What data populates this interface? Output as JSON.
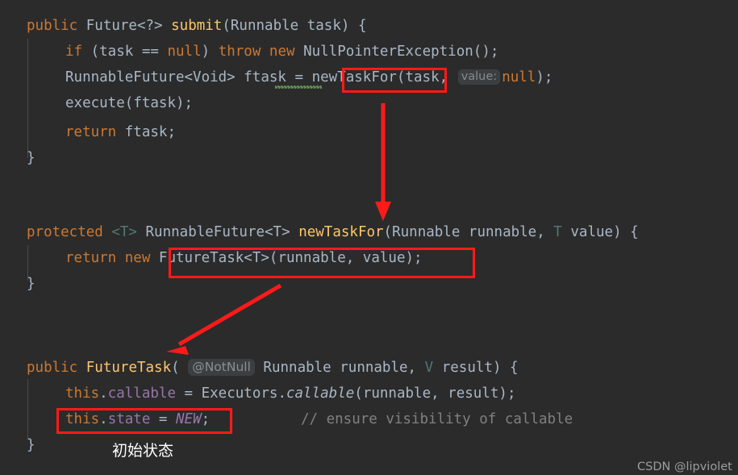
{
  "editor": {
    "background": "#2b2b2b",
    "default_text_color": "#a9b7c6",
    "keyword_color": "#cc7832",
    "method_color": "#ffc66d",
    "field_color": "#9876aa",
    "comment_color": "#808080",
    "annotation_color": "#ff1a1a",
    "language": "Java"
  },
  "code": {
    "block1": {
      "line1": {
        "kw_public": "public",
        "type_future": " Future<?> ",
        "method": "submit",
        "open_paren": "(",
        "param_type": "Runnable",
        "param_name": " task",
        "tail": ") {"
      },
      "line2": {
        "kw_if": "if",
        "cond_open": " (task ",
        "op_eq": "==",
        "kw_null": " null",
        "cond_close": ") ",
        "kw_throw": "throw",
        "kw_new": " new",
        "exception": " NullPointerException",
        "tail": "();"
      },
      "line3": {
        "decl_type": "RunnableFuture<Void>",
        "var": " ftask ",
        "assign": "= ",
        "call": "newTaskFor",
        "open_paren": "(",
        "arg1": "task, ",
        "hint": "value:",
        "arg2": "null",
        "tail": ");"
      },
      "line4": {
        "call": "execute",
        "open_paren": "(",
        "arg": "ftask",
        "tail": ");"
      },
      "line5": {
        "kw_return": "return",
        "value": " ftask",
        "tail": ";"
      },
      "line6": {
        "brace": "}"
      }
    },
    "block2": {
      "line1": {
        "kw_protected": "protected",
        "generic": " <T> ",
        "ret_type": "RunnableFuture<T>",
        "space": " ",
        "method": "newTaskFor",
        "open_paren": "(",
        "p1_type": "Runnable",
        "p1_name": " runnable, ",
        "p2_type": "T",
        "p2_name": " value",
        "tail": ") {"
      },
      "line2": {
        "kw_return": "return",
        "kw_new": " new",
        "space": " ",
        "ctor": "FutureTask<T>",
        "open_paren": "(",
        "args": "runnable, value",
        "tail": ");"
      },
      "line3": {
        "brace": "}"
      }
    },
    "block3": {
      "line1": {
        "kw_public": "public",
        "space": " ",
        "ctor": "FutureTask",
        "open_paren": "( ",
        "annotation": "@NotNull",
        "p1_type": " Runnable",
        "p1_name": " runnable, ",
        "p2_type": "V",
        "p2_name": " result",
        "tail": ") {"
      },
      "line2": {
        "kw_this": "this",
        "dot": ".",
        "field": "callable",
        "assign": " = ",
        "class_name": "Executors",
        "dot2": ".",
        "static_method": "callable",
        "open_paren": "(",
        "args": "runnable, result",
        "tail": ");"
      },
      "line3": {
        "kw_this": "this",
        "dot": ".",
        "field": "state",
        "assign": " = ",
        "static_field": "NEW",
        "tail": ";",
        "comment": "// ensure visibility of callable"
      },
      "line4": {
        "brace": "}"
      }
    }
  },
  "annotations": {
    "note_cn": "初始状态",
    "boxes": [
      {
        "label": "newTaskFor-call-box"
      },
      {
        "label": "futuretask-constructor-call-box"
      },
      {
        "label": "state-new-assignment-box"
      }
    ],
    "arrows": [
      {
        "label": "arrow-call-to-definition"
      },
      {
        "label": "arrow-definition-to-constructor"
      }
    ]
  },
  "watermark": {
    "text": "CSDN @lipviolet"
  }
}
